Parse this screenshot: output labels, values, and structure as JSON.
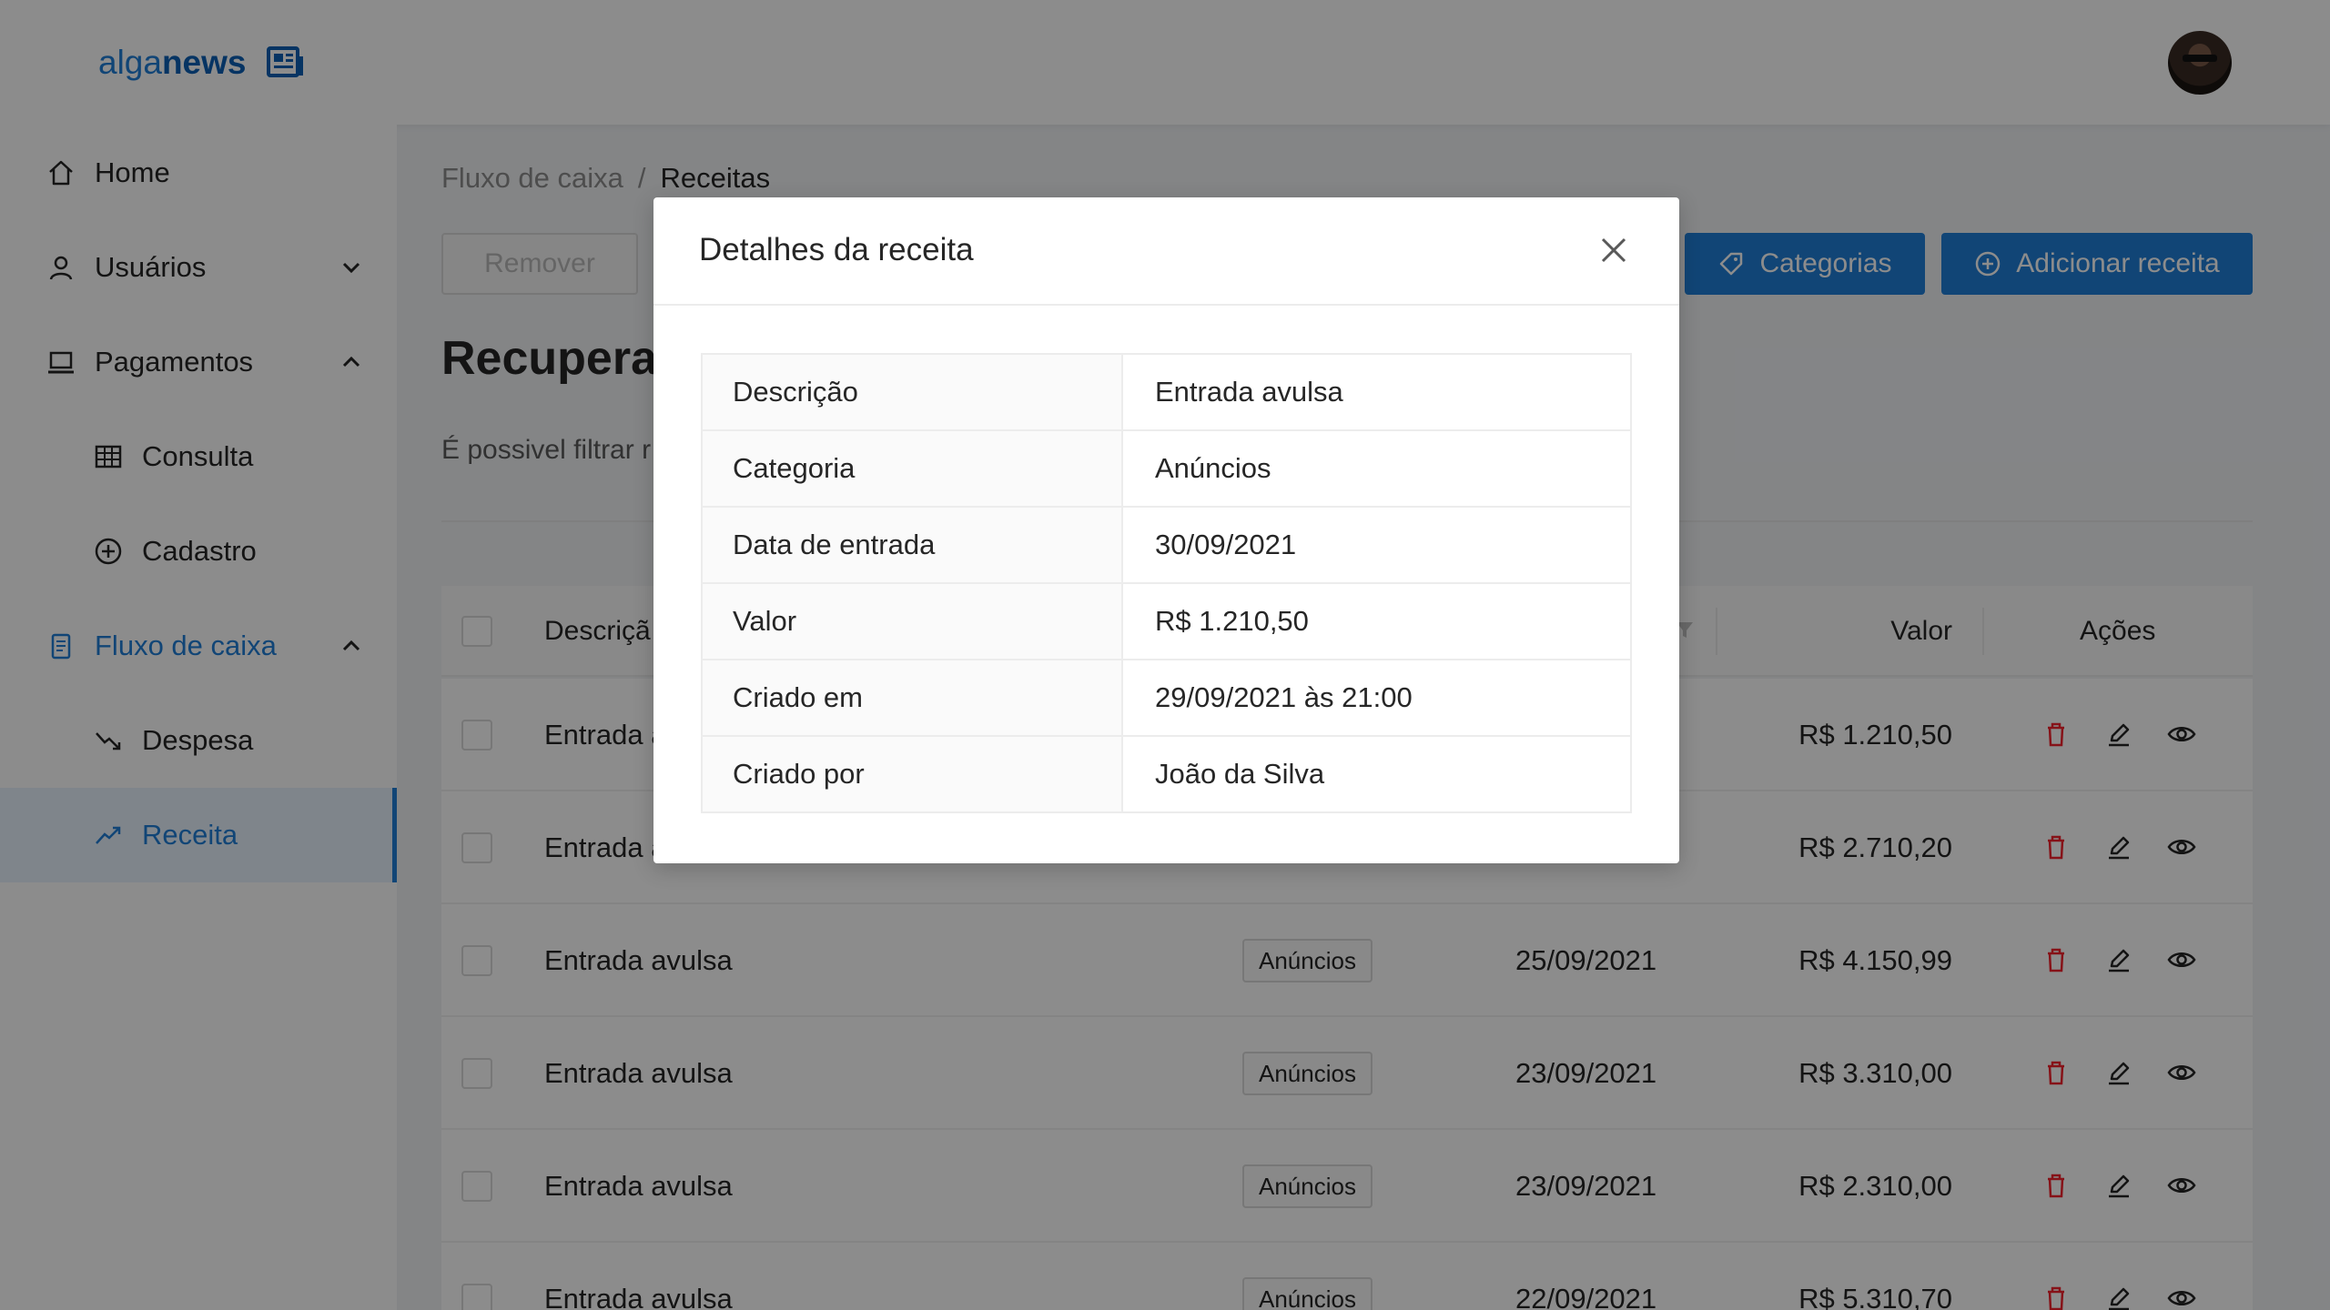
{
  "header": {
    "logo_prefix": "alga",
    "logo_suffix": "news",
    "logo_icon": "newspaper-icon",
    "avatar": "user-avatar"
  },
  "sidebar": {
    "items": [
      {
        "label": "Home",
        "icon": "home-icon"
      },
      {
        "label": "Usuários",
        "icon": "user-icon",
        "chevron": "down"
      },
      {
        "label": "Pagamentos",
        "icon": "laptop-icon",
        "chevron": "up"
      },
      {
        "label": "Consulta",
        "icon": "table-icon"
      },
      {
        "label": "Cadastro",
        "icon": "plus-circle-icon"
      },
      {
        "label": "Fluxo de caixa",
        "icon": "container-icon",
        "chevron": "up"
      },
      {
        "label": "Despesa",
        "icon": "fall-icon"
      },
      {
        "label": "Receita",
        "icon": "rise-icon"
      }
    ]
  },
  "breadcrumb": {
    "parent": "Fluxo de caixa",
    "separator": "/",
    "current": "Receitas"
  },
  "toolbar": {
    "remove_label": "Remover",
    "categories_label": "Categorias",
    "add_label": "Adicionar receita"
  },
  "page": {
    "title": "Recupera",
    "description": "É possivel filtrar r"
  },
  "table": {
    "headers": {
      "description": "Descriçã",
      "value": "Valor",
      "actions": "Ações"
    },
    "rows": [
      {
        "description": "Entrada a",
        "category": "",
        "date": "",
        "value": "R$ 1.210,50"
      },
      {
        "description": "Entrada a",
        "category": "",
        "date": "",
        "value": "R$ 2.710,20"
      },
      {
        "description": "Entrada avulsa",
        "category": "Anúncios",
        "date": "25/09/2021",
        "value": "R$ 4.150,99"
      },
      {
        "description": "Entrada avulsa",
        "category": "Anúncios",
        "date": "23/09/2021",
        "value": "R$ 3.310,00"
      },
      {
        "description": "Entrada avulsa",
        "category": "Anúncios",
        "date": "23/09/2021",
        "value": "R$ 2.310,00"
      },
      {
        "description": "Entrada avulsa",
        "category": "Anúncios",
        "date": "22/09/2021",
        "value": "R$ 5.310,70"
      }
    ]
  },
  "modal": {
    "title": "Detalhes da receita",
    "details": [
      {
        "key": "Descrição",
        "value": "Entrada avulsa"
      },
      {
        "key": "Categoria",
        "value": "Anúncios"
      },
      {
        "key": "Data de entrada",
        "value": "30/09/2021"
      },
      {
        "key": "Valor",
        "value": "R$ 1.210,50"
      },
      {
        "key": "Criado em",
        "value": "29/09/2021 às 21:00"
      },
      {
        "key": "Criado por",
        "value": "João da Silva"
      }
    ]
  },
  "colors": {
    "primary": "#1f7ed8",
    "danger": "#f5222d",
    "overlay": "rgba(0,0,0,0.45)"
  }
}
